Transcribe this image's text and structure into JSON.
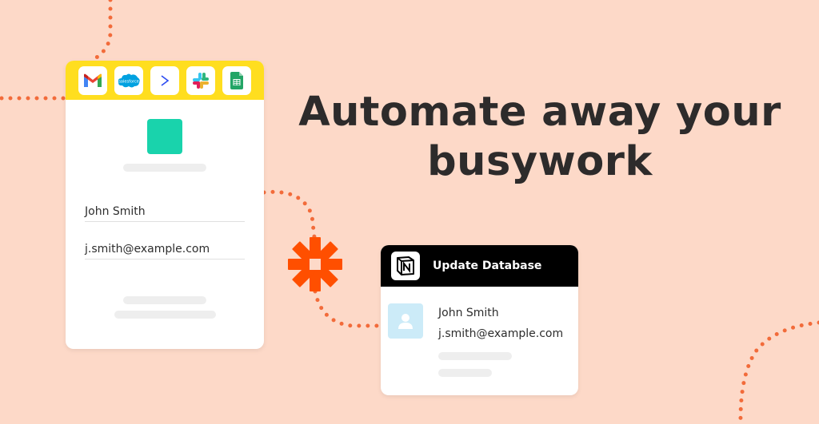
{
  "headline": {
    "line1": "Automate away your",
    "line2": "busywork"
  },
  "form_card": {
    "apps": [
      {
        "name": "gmail-icon"
      },
      {
        "name": "salesforce-icon",
        "label": "salesforce"
      },
      {
        "name": "forward-arrow-icon"
      },
      {
        "name": "slack-icon"
      },
      {
        "name": "google-sheets-icon"
      }
    ],
    "name_value": "John Smith",
    "email_value": "j.smith@example.com"
  },
  "db_card": {
    "title": "Update Database",
    "name": "John Smith",
    "email": "j.smith@example.com"
  },
  "colors": {
    "background": "#fdd9c8",
    "app_bar": "#ffde1f",
    "accent_green": "#19d3ac",
    "zapier_orange": "#ff4f00",
    "dots": "#f26b3a"
  }
}
